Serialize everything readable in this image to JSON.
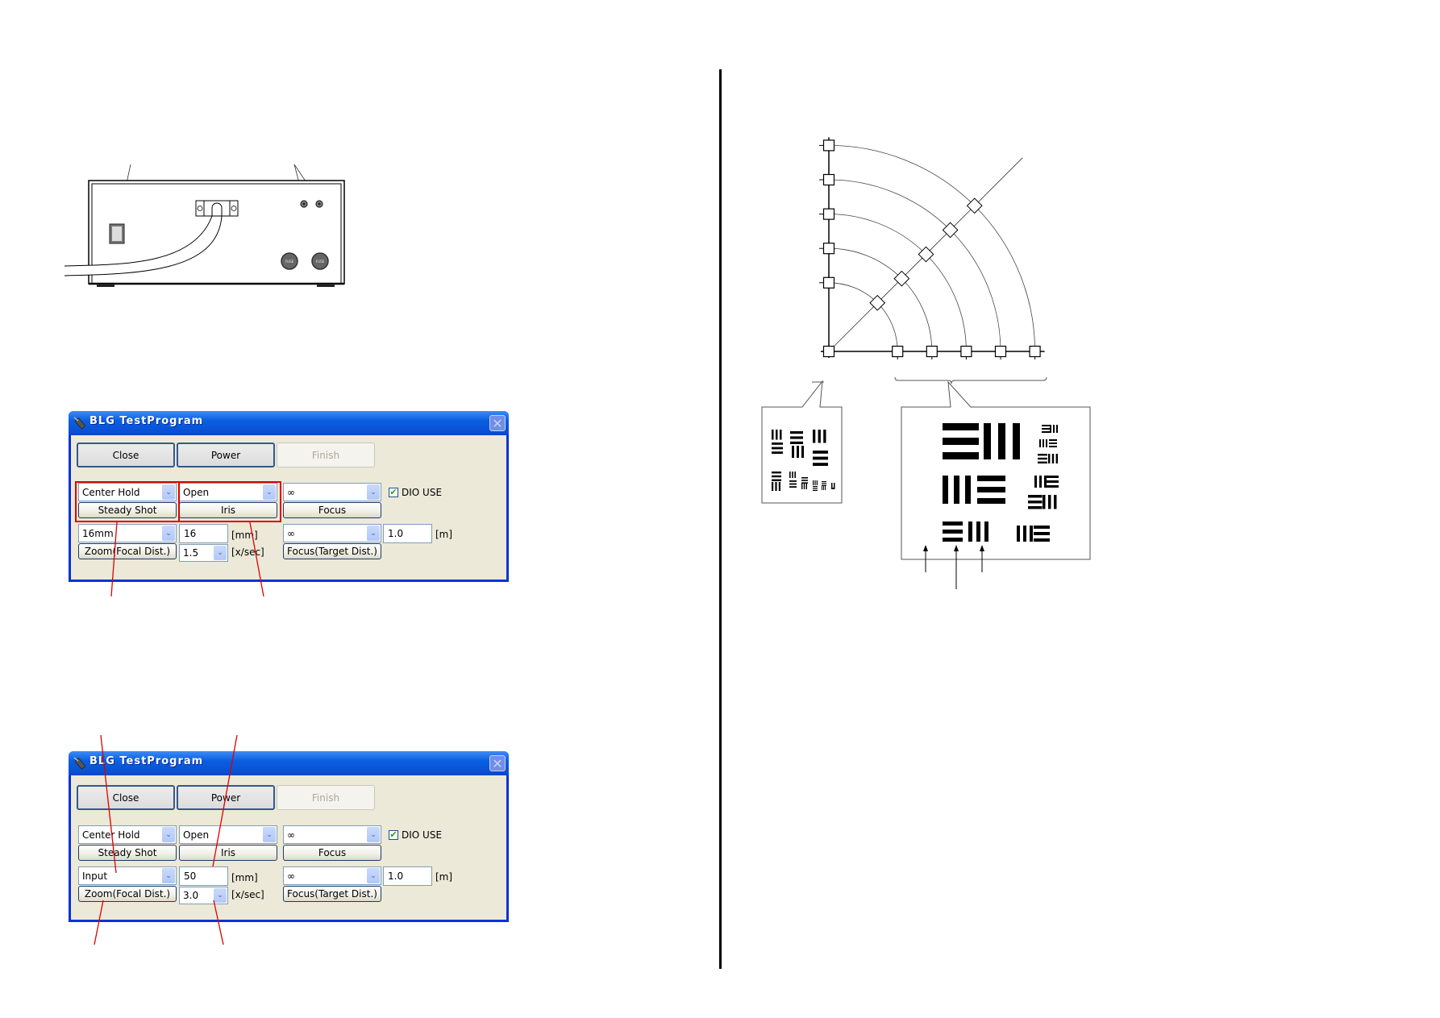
{
  "windows": [
    {
      "title": "BLG TestProgram",
      "close_glyph": "✕",
      "buttons": {
        "close": "Close",
        "power": "Power",
        "finish": "Finish"
      },
      "steady_shot": {
        "combo_value": "Center Hold",
        "button": "Steady Shot"
      },
      "iris": {
        "combo_value": "Open",
        "button": "Iris"
      },
      "focus": {
        "combo_value": "∞",
        "button": "Focus"
      },
      "dio_use": {
        "label": "DIO USE",
        "checked": true,
        "check_glyph": "✔"
      },
      "zoom": {
        "combo_value": "16mm",
        "button": "Zoom(Focal Dist.)"
      },
      "focal_mm": {
        "value": "16",
        "unit": "[mm]"
      },
      "speed": {
        "combo_value": "1.5",
        "unit": "[x/sec]"
      },
      "focus_target": {
        "combo_value": "∞",
        "button": "Focus(Target Dist.)"
      },
      "target_m": {
        "value": "1.0",
        "unit": "[m]"
      },
      "dropdown_glyph": "⌄"
    },
    {
      "title": "BLG TestProgram",
      "close_glyph": "✕",
      "buttons": {
        "close": "Close",
        "power": "Power",
        "finish": "Finish"
      },
      "steady_shot": {
        "combo_value": "Center Hold",
        "button": "Steady Shot"
      },
      "iris": {
        "combo_value": "Open",
        "button": "Iris"
      },
      "focus": {
        "combo_value": "∞",
        "button": "Focus"
      },
      "dio_use": {
        "label": "DIO USE",
        "checked": true,
        "check_glyph": "✔"
      },
      "zoom": {
        "combo_value": "Input",
        "button": "Zoom(Focal Dist.)"
      },
      "focal_mm": {
        "value": "50",
        "unit": "[mm]"
      },
      "speed": {
        "combo_value": "3.0",
        "unit": "[x/sec]"
      },
      "focus_target": {
        "combo_value": "∞",
        "button": "Focus(Target Dist.)"
      },
      "target_m": {
        "value": "1.0",
        "unit": "[m]"
      },
      "dropdown_glyph": "⌄"
    }
  ],
  "device": {
    "fuse_labels": [
      "FUSE",
      "FUSE"
    ]
  },
  "colors": {
    "annotation_red": "#e00000",
    "xp_title_blue": "#0a4fd6",
    "xp_face": "#ece9d8"
  }
}
